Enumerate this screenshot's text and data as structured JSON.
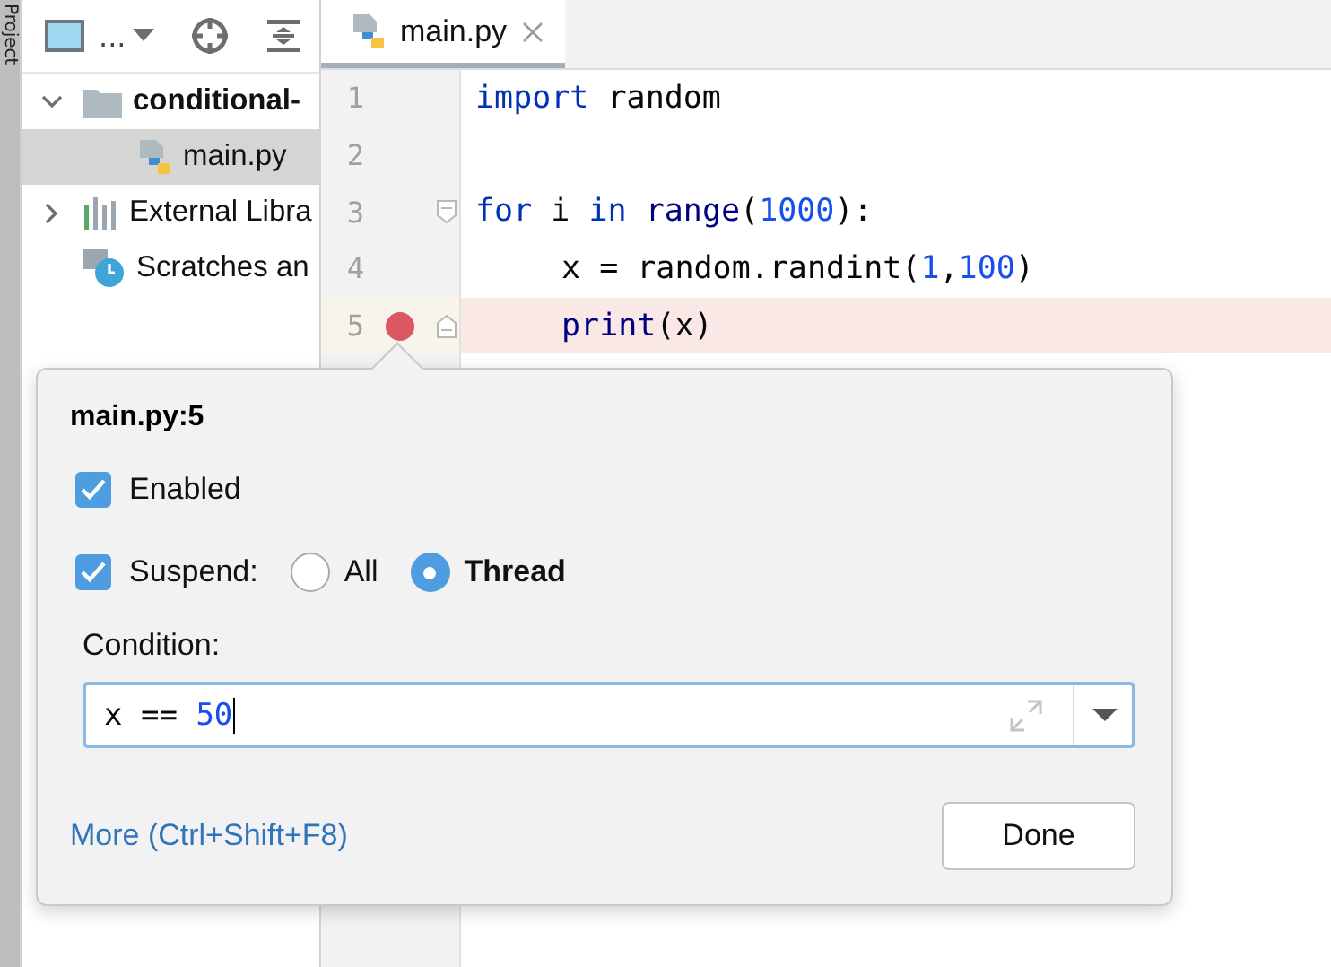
{
  "side_strip": {
    "label": "Project"
  },
  "project_toolbar": {
    "view_label": "..."
  },
  "project_tree": [
    {
      "label": "conditional-",
      "kind": "folder",
      "expanded": true,
      "selected": false,
      "children": [
        {
          "label": "main.py",
          "kind": "python",
          "selected": true
        }
      ]
    },
    {
      "label": "External Libra",
      "kind": "libraries",
      "expanded": false,
      "selected": false
    },
    {
      "label": "Scratches an",
      "kind": "scratches",
      "selected": false
    }
  ],
  "editor_tab": {
    "label": "main.py",
    "selected": true
  },
  "code_lines": [
    {
      "number": "1",
      "breakpoint": false,
      "fold_start": false,
      "fold_end": false,
      "indented": false,
      "tokens": [
        {
          "kind": "keyword",
          "text": "import"
        },
        {
          "kind": "plain",
          "text": " random"
        }
      ]
    },
    {
      "number": "2",
      "breakpoint": false,
      "fold_start": false,
      "fold_end": false
    },
    {
      "number": "3",
      "breakpoint": false,
      "fold_start": true,
      "fold_end": false,
      "indented": false,
      "tokens": [
        {
          "kind": "keyword",
          "text": "for"
        },
        {
          "kind": "plain",
          "text": " i "
        },
        {
          "kind": "keyword",
          "text": "in"
        },
        {
          "kind": "builtin",
          "text": " range"
        },
        {
          "kind": "plain",
          "text": "("
        },
        {
          "kind": "number",
          "text": "1000"
        },
        {
          "kind": "plain",
          "text": "):"
        }
      ]
    },
    {
      "number": "4",
      "breakpoint": false,
      "fold_start": false,
      "fold_end": false,
      "indented": true,
      "tokens": [
        {
          "kind": "plain",
          "text": "x = random.randint("
        },
        {
          "kind": "number",
          "text": "1"
        },
        {
          "kind": "plain",
          "text": ","
        },
        {
          "kind": "number",
          "text": "100"
        },
        {
          "kind": "plain",
          "text": ")"
        }
      ]
    },
    {
      "number": "5",
      "breakpoint": true,
      "fold_start": false,
      "fold_end": true,
      "indented": true,
      "tokens": [
        {
          "kind": "builtin",
          "text": "print"
        },
        {
          "kind": "plain",
          "text": "(x)"
        }
      ]
    }
  ],
  "popup": {
    "title": "main.py:5",
    "enabled": {
      "label": "Enabled",
      "checked": true
    },
    "suspend": {
      "label": "Suspend:",
      "checked": true
    },
    "suspend_options": [
      {
        "label": "All",
        "selected": false
      },
      {
        "label": "Thread",
        "selected": true
      }
    ],
    "condition_label": "Condition:",
    "condition_tokens": [
      {
        "kind": "plain",
        "text": "x == "
      },
      {
        "kind": "number",
        "text": "50"
      }
    ],
    "more_link": "More (Ctrl+Shift+F8)",
    "done_button": "Done"
  }
}
